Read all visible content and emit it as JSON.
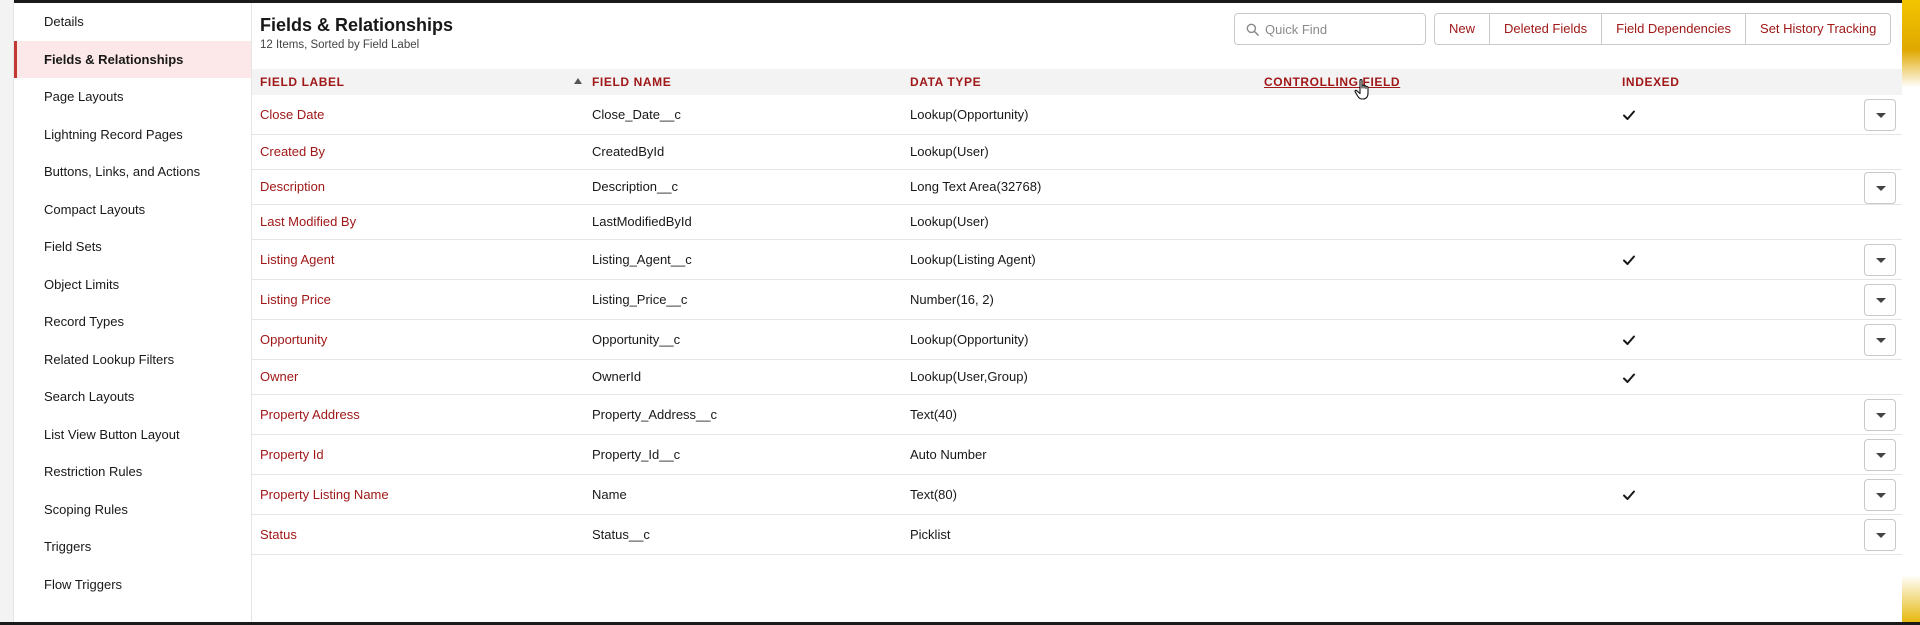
{
  "sidebar": {
    "items": [
      {
        "label": "Details",
        "active": false
      },
      {
        "label": "Fields & Relationships",
        "active": true
      },
      {
        "label": "Page Layouts",
        "active": false
      },
      {
        "label": "Lightning Record Pages",
        "active": false
      },
      {
        "label": "Buttons, Links, and Actions",
        "active": false
      },
      {
        "label": "Compact Layouts",
        "active": false
      },
      {
        "label": "Field Sets",
        "active": false
      },
      {
        "label": "Object Limits",
        "active": false
      },
      {
        "label": "Record Types",
        "active": false
      },
      {
        "label": "Related Lookup Filters",
        "active": false
      },
      {
        "label": "Search Layouts",
        "active": false
      },
      {
        "label": "List View Button Layout",
        "active": false
      },
      {
        "label": "Restriction Rules",
        "active": false
      },
      {
        "label": "Scoping Rules",
        "active": false
      },
      {
        "label": "Triggers",
        "active": false
      },
      {
        "label": "Flow Triggers",
        "active": false
      }
    ]
  },
  "header": {
    "title": "Fields & Relationships",
    "subtitle": "12 Items, Sorted by Field Label"
  },
  "search": {
    "placeholder": "Quick Find",
    "value": ""
  },
  "toolbar": {
    "buttons": [
      "New",
      "Deleted Fields",
      "Field Dependencies",
      "Set History Tracking"
    ]
  },
  "table": {
    "columns": {
      "field_label": "FIELD LABEL",
      "field_name": "FIELD NAME",
      "data_type": "DATA TYPE",
      "controlling_field": "CONTROLLING FIELD",
      "indexed": "INDEXED"
    },
    "sort": {
      "column": "field_label",
      "direction": "ascending"
    },
    "rows": [
      {
        "label": "Close Date",
        "name": "Close_Date__c",
        "type": "Lookup(Opportunity)",
        "indexed": true,
        "menu": true
      },
      {
        "label": "Created By",
        "name": "CreatedById",
        "type": "Lookup(User)",
        "indexed": false,
        "menu": false
      },
      {
        "label": "Description",
        "name": "Description__c",
        "type": "Long Text Area(32768)",
        "indexed": false,
        "menu": true
      },
      {
        "label": "Last Modified By",
        "name": "LastModifiedById",
        "type": "Lookup(User)",
        "indexed": false,
        "menu": false
      },
      {
        "label": "Listing Agent",
        "name": "Listing_Agent__c",
        "type": "Lookup(Listing Agent)",
        "indexed": true,
        "menu": true
      },
      {
        "label": "Listing Price",
        "name": "Listing_Price__c",
        "type": "Number(16, 2)",
        "indexed": false,
        "menu": true
      },
      {
        "label": "Opportunity",
        "name": "Opportunity__c",
        "type": "Lookup(Opportunity)",
        "indexed": true,
        "menu": true
      },
      {
        "label": "Owner",
        "name": "OwnerId",
        "type": "Lookup(User,Group)",
        "indexed": true,
        "menu": false
      },
      {
        "label": "Property Address",
        "name": "Property_Address__c",
        "type": "Text(40)",
        "indexed": false,
        "menu": true
      },
      {
        "label": "Property Id",
        "name": "Property_Id__c",
        "type": "Auto Number",
        "indexed": false,
        "menu": true
      },
      {
        "label": "Property Listing Name",
        "name": "Name",
        "type": "Text(80)",
        "indexed": true,
        "menu": true
      },
      {
        "label": "Status",
        "name": "Status__c",
        "type": "Picklist",
        "indexed": false,
        "menu": true
      }
    ]
  },
  "icons": {
    "search": "search-icon",
    "sort": "sort-ascending-icon",
    "check": "check-icon",
    "row_menu": "chevron-down-icon",
    "cursor": "hand-pointer-cursor"
  },
  "colors": {
    "accent": "#a01818",
    "active_bg": "#fce8e8",
    "header_bg": "#f3f3f3",
    "border": "#c9c9c9"
  }
}
